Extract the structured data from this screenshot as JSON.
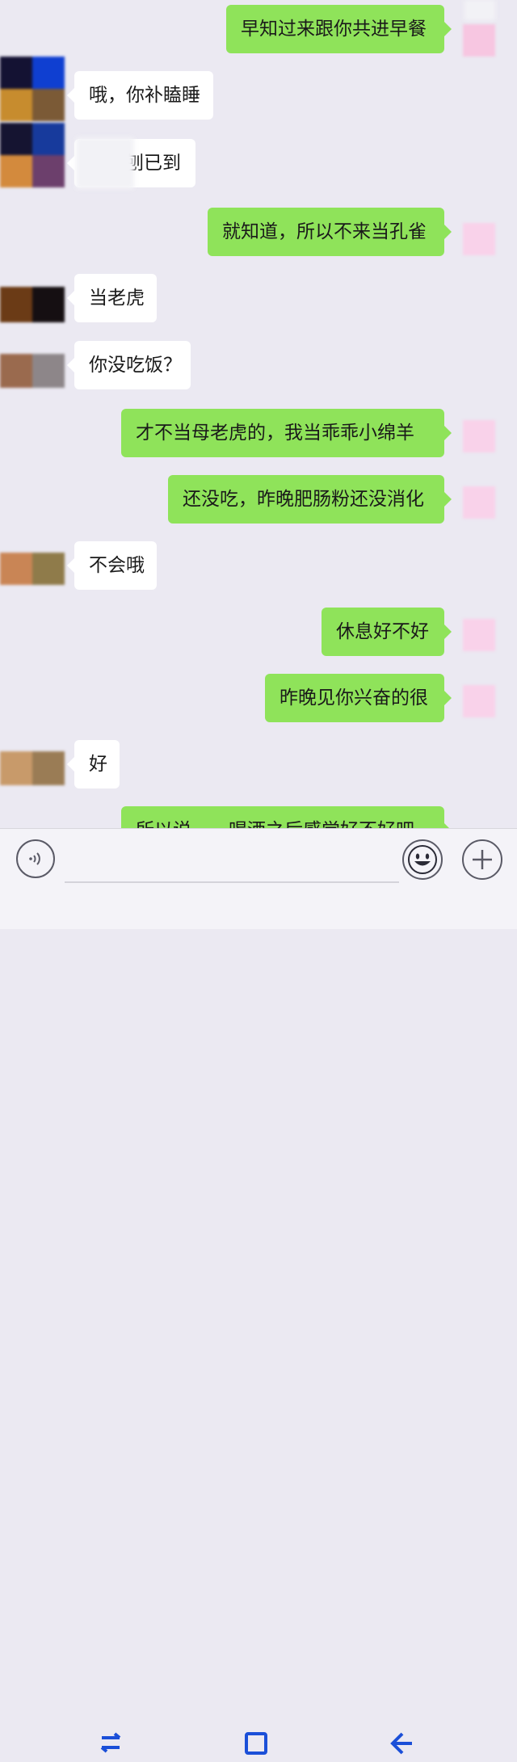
{
  "messages": [
    {
      "side": "out",
      "text": "早知过来跟你共进早餐"
    },
    {
      "side": "in",
      "text": "哦，你补瞌睡"
    },
    {
      "side": "in",
      "text": "刨已到"
    },
    {
      "side": "out",
      "text": "就知道，所以不来当孔雀"
    },
    {
      "side": "in",
      "text": "当老虎"
    },
    {
      "side": "in",
      "text": "你没吃饭？"
    },
    {
      "side": "out",
      "text": "才不当母老虎的，我当乖乖小绵羊"
    },
    {
      "side": "out",
      "text": "还没吃，昨晚肥肠粉还没消化"
    },
    {
      "side": "in",
      "text": "不会哦"
    },
    {
      "side": "out",
      "text": "休息好不好"
    },
    {
      "side": "out",
      "text": "昨晚见你兴奋的很"
    },
    {
      "side": "in",
      "text": "好"
    },
    {
      "side": "out",
      "text": "所以说……喝酒之后感觉好不好吧"
    }
  ],
  "input_bar": {
    "voice_icon": "voice-wave-icon",
    "emoji_icon": "smiley-face-icon",
    "plus_icon": "plus-icon",
    "placeholder": ""
  },
  "nav_bar": {
    "recent_icon": "recent-apps-icon",
    "home_icon": "home-icon",
    "back_icon": "back-arrow-icon"
  },
  "colors": {
    "background": "#ebe9f2",
    "outgoing_bubble": "#8fe35a",
    "incoming_bubble": "#ffffff",
    "nav_icon": "#1b4fd8"
  }
}
